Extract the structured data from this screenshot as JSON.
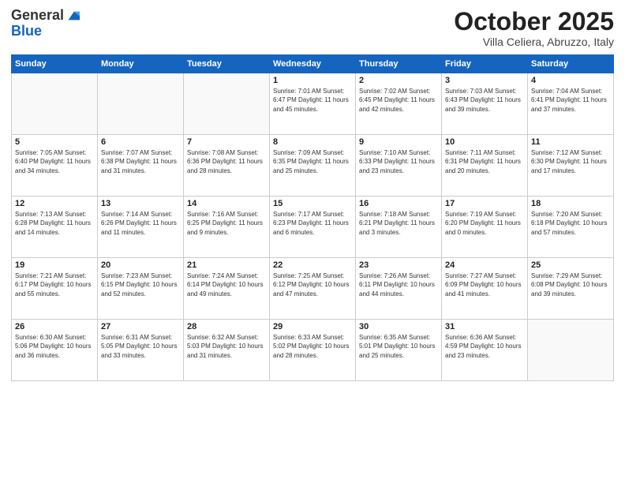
{
  "header": {
    "logo_line1": "General",
    "logo_line2": "Blue",
    "title": "October 2025",
    "subtitle": "Villa Celiera, Abruzzo, Italy"
  },
  "days_of_week": [
    "Sunday",
    "Monday",
    "Tuesday",
    "Wednesday",
    "Thursday",
    "Friday",
    "Saturday"
  ],
  "weeks": [
    [
      {
        "num": "",
        "info": ""
      },
      {
        "num": "",
        "info": ""
      },
      {
        "num": "",
        "info": ""
      },
      {
        "num": "1",
        "info": "Sunrise: 7:01 AM\nSunset: 6:47 PM\nDaylight: 11 hours and 45 minutes."
      },
      {
        "num": "2",
        "info": "Sunrise: 7:02 AM\nSunset: 6:45 PM\nDaylight: 11 hours and 42 minutes."
      },
      {
        "num": "3",
        "info": "Sunrise: 7:03 AM\nSunset: 6:43 PM\nDaylight: 11 hours and 39 minutes."
      },
      {
        "num": "4",
        "info": "Sunrise: 7:04 AM\nSunset: 6:41 PM\nDaylight: 11 hours and 37 minutes."
      }
    ],
    [
      {
        "num": "5",
        "info": "Sunrise: 7:05 AM\nSunset: 6:40 PM\nDaylight: 11 hours and 34 minutes."
      },
      {
        "num": "6",
        "info": "Sunrise: 7:07 AM\nSunset: 6:38 PM\nDaylight: 11 hours and 31 minutes."
      },
      {
        "num": "7",
        "info": "Sunrise: 7:08 AM\nSunset: 6:36 PM\nDaylight: 11 hours and 28 minutes."
      },
      {
        "num": "8",
        "info": "Sunrise: 7:09 AM\nSunset: 6:35 PM\nDaylight: 11 hours and 25 minutes."
      },
      {
        "num": "9",
        "info": "Sunrise: 7:10 AM\nSunset: 6:33 PM\nDaylight: 11 hours and 23 minutes."
      },
      {
        "num": "10",
        "info": "Sunrise: 7:11 AM\nSunset: 6:31 PM\nDaylight: 11 hours and 20 minutes."
      },
      {
        "num": "11",
        "info": "Sunrise: 7:12 AM\nSunset: 6:30 PM\nDaylight: 11 hours and 17 minutes."
      }
    ],
    [
      {
        "num": "12",
        "info": "Sunrise: 7:13 AM\nSunset: 6:28 PM\nDaylight: 11 hours and 14 minutes."
      },
      {
        "num": "13",
        "info": "Sunrise: 7:14 AM\nSunset: 6:26 PM\nDaylight: 11 hours and 11 minutes."
      },
      {
        "num": "14",
        "info": "Sunrise: 7:16 AM\nSunset: 6:25 PM\nDaylight: 11 hours and 9 minutes."
      },
      {
        "num": "15",
        "info": "Sunrise: 7:17 AM\nSunset: 6:23 PM\nDaylight: 11 hours and 6 minutes."
      },
      {
        "num": "16",
        "info": "Sunrise: 7:18 AM\nSunset: 6:21 PM\nDaylight: 11 hours and 3 minutes."
      },
      {
        "num": "17",
        "info": "Sunrise: 7:19 AM\nSunset: 6:20 PM\nDaylight: 11 hours and 0 minutes."
      },
      {
        "num": "18",
        "info": "Sunrise: 7:20 AM\nSunset: 6:18 PM\nDaylight: 10 hours and 57 minutes."
      }
    ],
    [
      {
        "num": "19",
        "info": "Sunrise: 7:21 AM\nSunset: 6:17 PM\nDaylight: 10 hours and 55 minutes."
      },
      {
        "num": "20",
        "info": "Sunrise: 7:23 AM\nSunset: 6:15 PM\nDaylight: 10 hours and 52 minutes."
      },
      {
        "num": "21",
        "info": "Sunrise: 7:24 AM\nSunset: 6:14 PM\nDaylight: 10 hours and 49 minutes."
      },
      {
        "num": "22",
        "info": "Sunrise: 7:25 AM\nSunset: 6:12 PM\nDaylight: 10 hours and 47 minutes."
      },
      {
        "num": "23",
        "info": "Sunrise: 7:26 AM\nSunset: 6:11 PM\nDaylight: 10 hours and 44 minutes."
      },
      {
        "num": "24",
        "info": "Sunrise: 7:27 AM\nSunset: 6:09 PM\nDaylight: 10 hours and 41 minutes."
      },
      {
        "num": "25",
        "info": "Sunrise: 7:29 AM\nSunset: 6:08 PM\nDaylight: 10 hours and 39 minutes."
      }
    ],
    [
      {
        "num": "26",
        "info": "Sunrise: 6:30 AM\nSunset: 5:06 PM\nDaylight: 10 hours and 36 minutes."
      },
      {
        "num": "27",
        "info": "Sunrise: 6:31 AM\nSunset: 5:05 PM\nDaylight: 10 hours and 33 minutes."
      },
      {
        "num": "28",
        "info": "Sunrise: 6:32 AM\nSunset: 5:03 PM\nDaylight: 10 hours and 31 minutes."
      },
      {
        "num": "29",
        "info": "Sunrise: 6:33 AM\nSunset: 5:02 PM\nDaylight: 10 hours and 28 minutes."
      },
      {
        "num": "30",
        "info": "Sunrise: 6:35 AM\nSunset: 5:01 PM\nDaylight: 10 hours and 25 minutes."
      },
      {
        "num": "31",
        "info": "Sunrise: 6:36 AM\nSunset: 4:59 PM\nDaylight: 10 hours and 23 minutes."
      },
      {
        "num": "",
        "info": ""
      }
    ]
  ]
}
